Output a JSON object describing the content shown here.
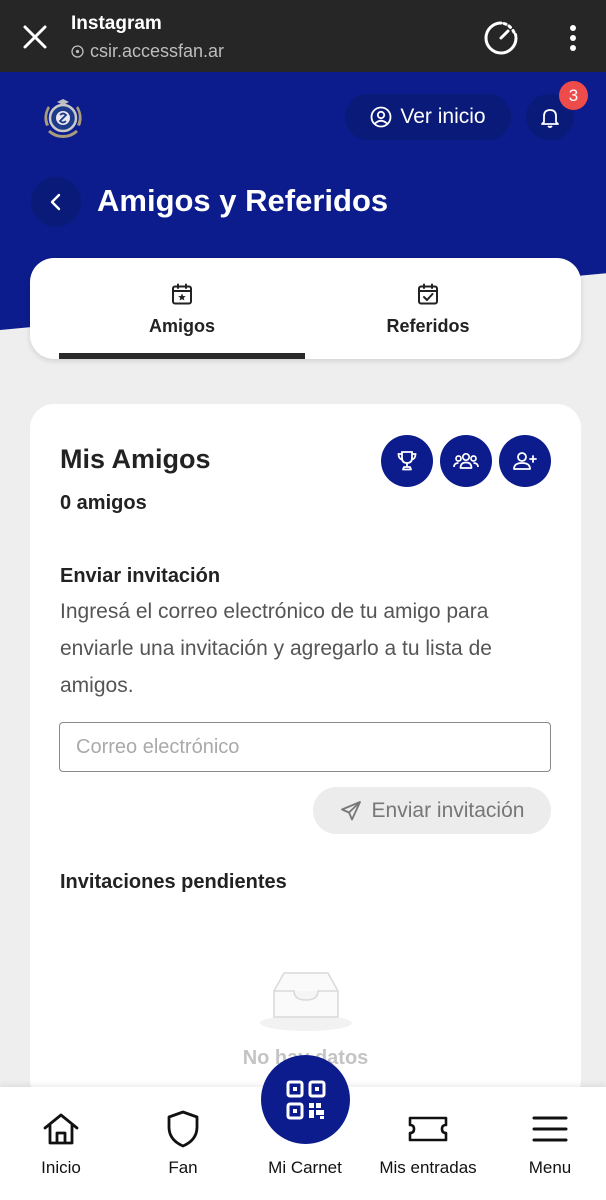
{
  "browser": {
    "title": "Instagram",
    "url": "csir.accessfan.ar"
  },
  "header": {
    "ver_inicio_label": "Ver inicio",
    "notification_count": "3",
    "title": "Amigos y Referidos"
  },
  "tabs": [
    {
      "label": "Amigos",
      "active": true
    },
    {
      "label": "Referidos",
      "active": false
    }
  ],
  "main": {
    "title": "Mis Amigos",
    "count_label": "0 amigos",
    "invite": {
      "title": "Enviar invitación",
      "description": "Ingresá el correo electrónico de tu amigo para enviarle una invitación y agregarlo a tu lista de amigos.",
      "email_placeholder": "Correo electrónico",
      "email_value": "",
      "send_label": "Enviar invitación"
    },
    "pending": {
      "title": "Invitaciones pendientes",
      "empty_text": "No hay datos"
    }
  },
  "bottom_nav": [
    {
      "label": "Inicio",
      "icon": "home-icon"
    },
    {
      "label": "Fan",
      "icon": "shield-icon"
    },
    {
      "label": "Mi Carnet",
      "icon": "qr-code-icon"
    },
    {
      "label": "Mis entradas",
      "icon": "ticket-icon"
    },
    {
      "label": "Menu",
      "icon": "menu-icon"
    }
  ],
  "colors": {
    "primary": "#0c1c8c",
    "browser_bar": "#262626",
    "badge": "#ee4b4b",
    "background": "#eeeeee"
  }
}
